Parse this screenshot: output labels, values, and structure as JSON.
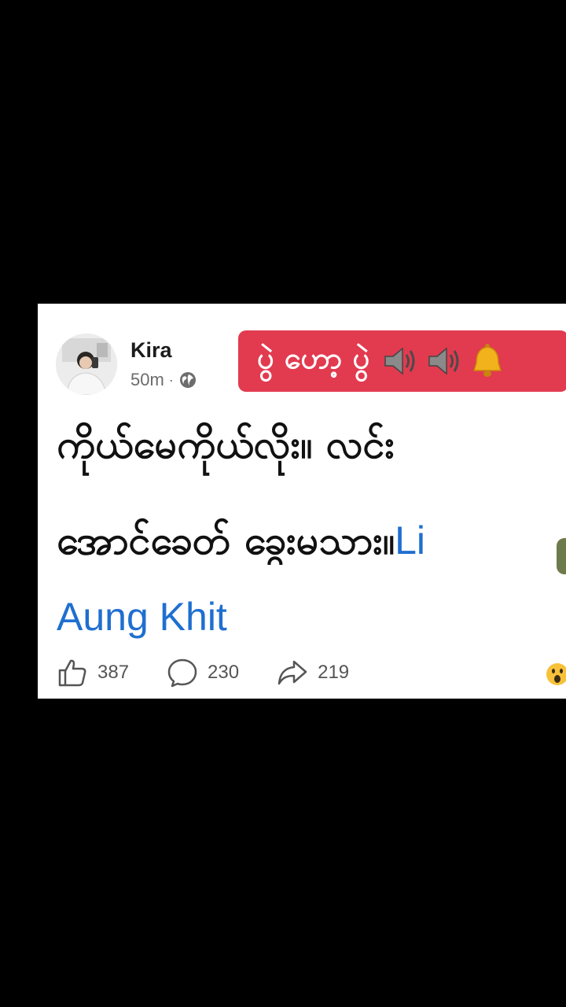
{
  "post": {
    "author": "Kira",
    "time": "50m",
    "separator": "·",
    "privacy_icon": "globe-icon",
    "banner": {
      "text": "ပွဲ ဟော့ ပွဲ",
      "icons": [
        "speaker-icon",
        "speaker-icon",
        "bell-icon"
      ],
      "color": "#e23a4f"
    },
    "headline_line1": "ကိုယ်မေကိုယ်လိုး။ လင်း",
    "headline_line2": "အောင်ခေတ် ခွေးမသား။",
    "headline_link_start": "Li",
    "mention": "Aung Khit",
    "link_color": "#1f6fd0"
  },
  "actions": {
    "like_icon": "thumbs-up-icon",
    "like_count": "387",
    "comment_icon": "comment-icon",
    "comment_count": "230",
    "share_icon": "share-icon",
    "share_count": "219",
    "reaction_icon": "wow-reaction-icon"
  }
}
